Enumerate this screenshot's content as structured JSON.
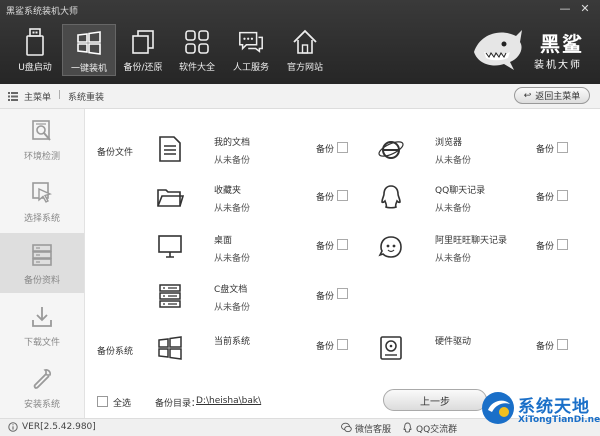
{
  "window": {
    "title": "黑鲨系统装机大师",
    "minimize": "—",
    "close": "✕"
  },
  "nav": [
    {
      "label": "U盘启动",
      "icon": "usb-icon"
    },
    {
      "label": "一键装机",
      "icon": "windows-icon",
      "active": true
    },
    {
      "label": "备份/还原",
      "icon": "backup-restore-icon"
    },
    {
      "label": "软件大全",
      "icon": "apps-grid-icon"
    },
    {
      "label": "人工服务",
      "icon": "chat-icon"
    },
    {
      "label": "官方网站",
      "icon": "home-icon"
    }
  ],
  "brand": {
    "line1": "黑鲨",
    "line2": "装机大师"
  },
  "breadcrumb": {
    "root": "主菜单",
    "separator": "|",
    "current": "系统重装",
    "back": "返回主菜单"
  },
  "sidebar": [
    {
      "label": "环境检测",
      "icon": "env-check-icon"
    },
    {
      "label": "选择系统",
      "icon": "cursor-icon"
    },
    {
      "label": "备份资料",
      "icon": "database-icon",
      "active": true
    },
    {
      "label": "下载文件",
      "icon": "download-icon"
    },
    {
      "label": "安装系统",
      "icon": "wrench-icon"
    }
  ],
  "sections": {
    "files": "备份文件",
    "system": "备份系统"
  },
  "backup_label": "备份",
  "items": [
    {
      "name": "我的文档",
      "status": "从未备份",
      "icon": "document-icon"
    },
    {
      "name": "浏览器",
      "status": "从未备份",
      "icon": "ie-browser-icon"
    },
    {
      "name": "收藏夹",
      "status": "从未备份",
      "icon": "folder-icon"
    },
    {
      "name": "QQ聊天记录",
      "status": "从未备份",
      "icon": "qq-penguin-icon"
    },
    {
      "name": "桌面",
      "status": "从未备份",
      "icon": "monitor-icon"
    },
    {
      "name": "阿里旺旺聊天记录",
      "status": "从未备份",
      "icon": "wangwang-icon"
    },
    {
      "name": "C盘文档",
      "status": "从未备份",
      "icon": "server-icon"
    },
    {
      "name": "当前系统",
      "icon": "windows-icon"
    },
    {
      "name": "硬件驱动",
      "icon": "hard-drive-icon"
    }
  ],
  "footer": {
    "select_all": "全选",
    "dir_label": "备份目录：",
    "dir_value": "D:\\heisha\\bak\\",
    "prev": "上一步"
  },
  "statusbar": {
    "version": "VER[2.5.42.980]",
    "wechat": "微信客服",
    "qq": "QQ交流群"
  },
  "watermark": {
    "line1": "系统天地",
    "line2": "XiTongTianDi.net"
  }
}
